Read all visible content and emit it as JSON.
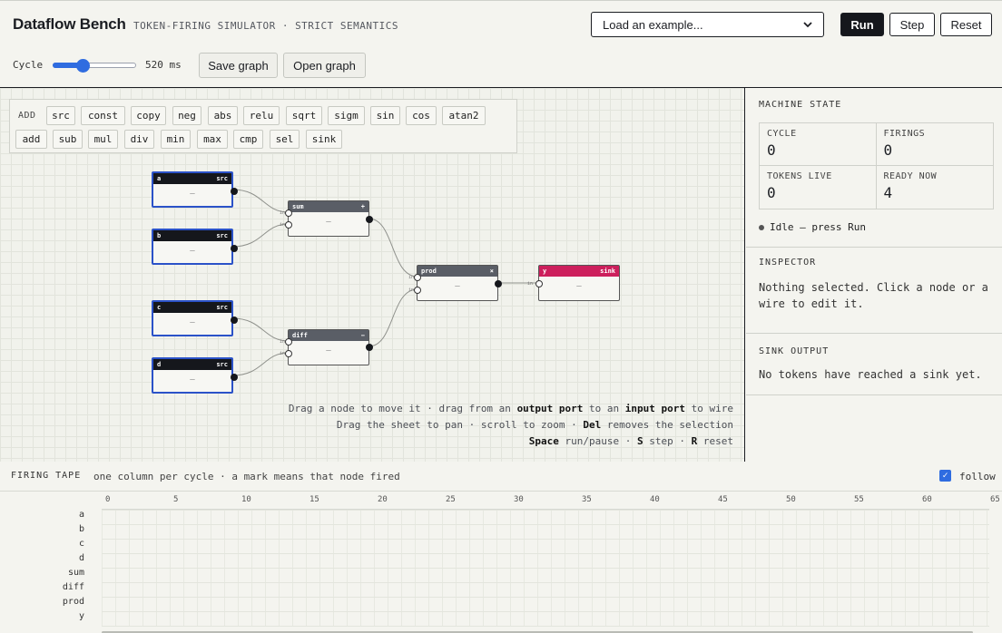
{
  "header": {
    "title": "Dataflow Bench",
    "subtitle": "TOKEN-FIRING SIMULATOR · STRICT SEMANTICS",
    "example_select": {
      "value": "Load an example..."
    },
    "run_label": "Run",
    "step_label": "Step",
    "reset_label": "Reset",
    "cycle_label": "Cycle",
    "cycle_ms": "520 ms",
    "cycle_slider_fraction": 0.36,
    "save_label": "Save graph",
    "open_label": "Open graph"
  },
  "palette": {
    "label": "ADD",
    "row1": [
      "src",
      "const",
      "copy",
      "neg",
      "abs",
      "relu",
      "sqrt",
      "sigm",
      "sin",
      "cos",
      "atan2"
    ],
    "row2": [
      "add",
      "sub",
      "mul",
      "div",
      "min",
      "max",
      "cmp",
      "sel",
      "sink"
    ]
  },
  "nodes": [
    {
      "name": "a",
      "kind": "src",
      "value": "—"
    },
    {
      "name": "b",
      "kind": "src",
      "value": "—"
    },
    {
      "name": "c",
      "kind": "src",
      "value": "—"
    },
    {
      "name": "d",
      "kind": "src",
      "value": "—"
    },
    {
      "name": "sum",
      "kind": "+",
      "value": "—"
    },
    {
      "name": "diff",
      "kind": "−",
      "value": "—"
    },
    {
      "name": "prod",
      "kind": "×",
      "value": "—"
    },
    {
      "name": "y",
      "kind": "sink",
      "value": "—"
    }
  ],
  "hints": {
    "line1": {
      "a": "Drag a node to move it · drag from an ",
      "b": "output port",
      "c": " to an ",
      "d": "input port",
      "e": " to wire"
    },
    "line2": {
      "a": "Drag the sheet to pan · scroll to zoom · ",
      "b": "Del",
      "c": " removes the selection"
    },
    "line3": {
      "a": "Space",
      "b": " run/pause · ",
      "c": "S",
      "d": " step · ",
      "e": "R",
      "f": " reset"
    }
  },
  "machine_state": {
    "heading": "MACHINE STATE",
    "cycle_label": "CYCLE",
    "cycle": "0",
    "firings_label": "FIRINGS",
    "firings": "0",
    "tokens_label": "TOKENS LIVE",
    "tokens": "0",
    "ready_label": "READY NOW",
    "ready": "4",
    "status": "Idle — press Run"
  },
  "inspector": {
    "heading": "INSPECTOR",
    "text": "Nothing selected. Click a node or a wire to edit it."
  },
  "sink_output": {
    "heading": "SINK OUTPUT",
    "text": "No tokens have reached a sink yet."
  },
  "tape": {
    "heading": "FIRING TAPE",
    "desc": "one column per cycle · a mark means that node fired",
    "follow_label": "follow",
    "follow_checked": true,
    "ticks": [
      "0",
      "5",
      "10",
      "15",
      "20",
      "25",
      "30",
      "35",
      "40",
      "45",
      "50",
      "55",
      "60",
      "65"
    ],
    "rows": [
      "a",
      "b",
      "c",
      "d",
      "sum",
      "diff",
      "prod",
      "y"
    ]
  },
  "colors": {
    "accent": "#2f6ce0",
    "sink": "#cc1f5c",
    "src_border": "#2b52c8",
    "ink": "#15171c"
  }
}
